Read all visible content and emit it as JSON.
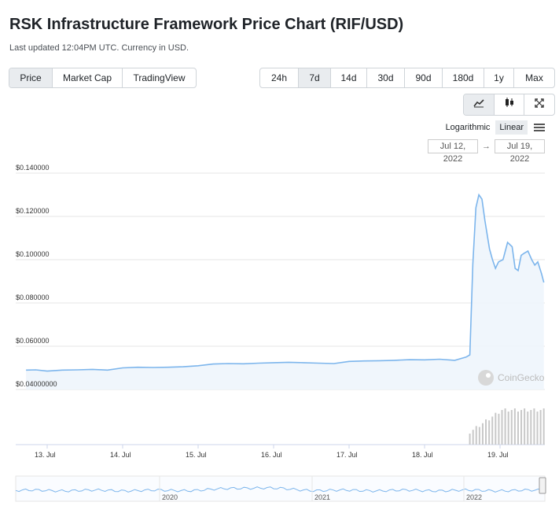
{
  "header": {
    "title": "RSK Infrastructure Framework Price Chart (RIF/USD)",
    "subtitle": "Last updated 12:04PM UTC. Currency in USD."
  },
  "view_tabs": [
    {
      "label": "Price",
      "active": true
    },
    {
      "label": "Market Cap",
      "active": false
    },
    {
      "label": "TradingView",
      "active": false
    }
  ],
  "range_tabs": [
    {
      "label": "24h",
      "active": false
    },
    {
      "label": "7d",
      "active": true
    },
    {
      "label": "14d",
      "active": false
    },
    {
      "label": "30d",
      "active": false
    },
    {
      "label": "90d",
      "active": false
    },
    {
      "label": "180d",
      "active": false
    },
    {
      "label": "1y",
      "active": false
    },
    {
      "label": "Max",
      "active": false
    }
  ],
  "chart_type_icons": [
    "line-chart-icon",
    "candlestick-icon",
    "fullscreen-icon"
  ],
  "scale": {
    "logarithmic": "Logarithmic",
    "linear": "Linear",
    "active": "linear"
  },
  "date_range": {
    "from": "Jul 12, 2022",
    "to": "Jul 19, 2022",
    "arrow": "→"
  },
  "watermark": "CoinGecko",
  "colors": {
    "line": "#7cb5ec",
    "fill": "#eef5fc",
    "volume": "#c8c8c8",
    "grid": "#e6e6e6"
  },
  "chart_data": {
    "type": "line",
    "title": "",
    "xlabel": "",
    "ylabel": "",
    "ylim": [
      0.03,
      0.14
    ],
    "y_tick_labels": [
      "$0.140000",
      "$0.120000",
      "$0.100000",
      "$0.080000",
      "$0.060000",
      "$0.04000000"
    ],
    "y_tick_values": [
      0.14,
      0.12,
      0.1,
      0.08,
      0.06,
      0.04
    ],
    "x_tick_labels": [
      "13. Jul",
      "14. Jul",
      "15. Jul",
      "16. Jul",
      "17. Jul",
      "18. Jul",
      "19. Jul"
    ],
    "x_tick_days": [
      13,
      14,
      15,
      16,
      17,
      18,
      19
    ],
    "grid": true,
    "series": [
      {
        "values_day": [
          12.72,
          12.85,
          13.0,
          13.2,
          13.4,
          13.6,
          13.8,
          14.0,
          14.2,
          14.4,
          14.6,
          14.8,
          15.0,
          15.2,
          15.4,
          15.6,
          15.8,
          16.0,
          16.2,
          16.4,
          16.6,
          16.8,
          17.0,
          17.2,
          17.4,
          17.6,
          17.8,
          18.0,
          18.2,
          18.4,
          18.5,
          18.55,
          18.6,
          18.64,
          18.68,
          18.72,
          18.76,
          18.8,
          18.86,
          18.9,
          18.94,
          18.98,
          19.04,
          19.1,
          19.16,
          19.2,
          19.24,
          19.28,
          19.32,
          19.37,
          19.42,
          19.46,
          19.5,
          19.55,
          19.58
        ],
        "values": [
          0.049,
          0.0491,
          0.0485,
          0.049,
          0.0491,
          0.0493,
          0.049,
          0.05,
          0.0503,
          0.0502,
          0.0503,
          0.0505,
          0.051,
          0.0518,
          0.052,
          0.0519,
          0.0522,
          0.0524,
          0.0526,
          0.0524,
          0.0522,
          0.052,
          0.053,
          0.0532,
          0.0533,
          0.0535,
          0.0538,
          0.0537,
          0.054,
          0.0535,
          0.0545,
          0.055,
          0.056,
          0.098,
          0.124,
          0.13,
          0.128,
          0.118,
          0.105,
          0.1,
          0.096,
          0.099,
          0.1,
          0.108,
          0.106,
          0.096,
          0.095,
          0.102,
          0.103,
          0.104,
          0.1,
          0.0975,
          0.099,
          0.0935,
          0.0895
        ]
      }
    ],
    "volume_start_day": 18.6,
    "volume_end_day": 19.58,
    "navigator_labels": [
      "2020",
      "2021",
      "2022"
    ]
  }
}
